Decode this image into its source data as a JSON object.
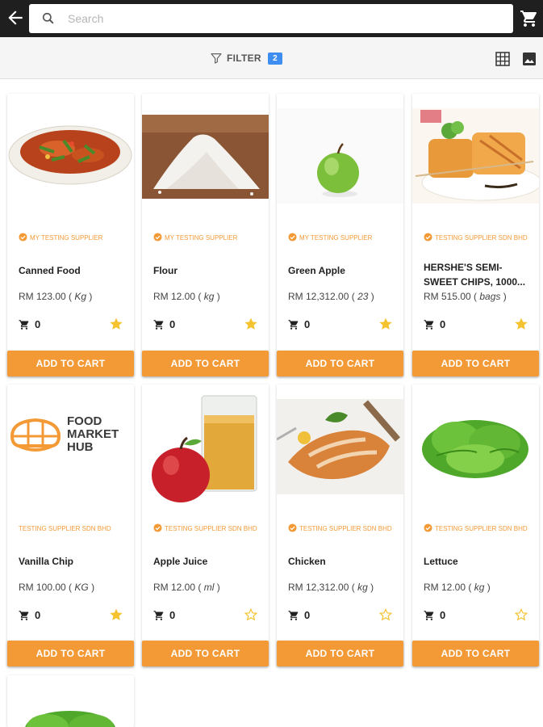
{
  "header": {
    "back_icon": "arrow-back-icon",
    "search_placeholder": "Search",
    "cart_icon": "cart-icon"
  },
  "toolbar": {
    "filter_label": "FILTER",
    "filter_count": "2",
    "view_icons": [
      "grid-view-icon",
      "image-view-icon"
    ]
  },
  "colors": {
    "accent": "#f39a37",
    "badge": "#3d8ef0",
    "star": "#f5c330",
    "topbar": "#1f1f1f"
  },
  "products": [
    {
      "supplier": "MY TESTING SUPPLIER",
      "name": "Canned Food",
      "price": "RM 123.00 (",
      "unit": "Kg",
      "price_end": ")",
      "cart": "0",
      "favorite": true,
      "image": "canned-food-image",
      "button": "ADD TO CART"
    },
    {
      "supplier": "MY TESTING SUPPLIER",
      "name": "Flour",
      "price": "RM 12.00 (",
      "unit": "kg",
      "price_end": ")",
      "cart": "0",
      "favorite": true,
      "image": "flour-image",
      "button": "ADD TO CART"
    },
    {
      "supplier": "MY TESTING SUPPLIER",
      "name": "Green Apple",
      "price": "RM 12,312.00 (",
      "unit": "23",
      "price_end": ")",
      "cart": "0",
      "favorite": true,
      "image": "green-apple-image",
      "button": "ADD TO CART"
    },
    {
      "supplier": "TESTING SUPPLIER SDN BHD",
      "name": "HERSHE'S SEMI-SWEET CHIPS, 1000...",
      "price": "RM 515.00 (",
      "unit": "bags",
      "price_end": ")",
      "cart": "0",
      "favorite": true,
      "image": "hershes-chips-image",
      "button": "ADD TO CART"
    },
    {
      "supplier": "TESTING SUPPLIER SDN BHD",
      "name": "Vanilla Chip",
      "price": "RM 100.00 (",
      "unit": "KG",
      "price_end": ")",
      "cart": "0",
      "favorite": true,
      "image": "food-market-hub-logo",
      "logo_text": [
        "FOOD",
        "MARKET",
        "HUB"
      ],
      "button": "ADD TO CART"
    },
    {
      "supplier": "TESTING SUPPLIER SDN BHD",
      "name": "Apple Juice",
      "price": "RM 12.00 (",
      "unit": "ml",
      "price_end": ")",
      "cart": "0",
      "favorite": false,
      "image": "apple-juice-image",
      "button": "ADD TO CART"
    },
    {
      "supplier": "TESTING SUPPLIER SDN BHD",
      "name": "Chicken",
      "price": "RM 12,312.00 (",
      "unit": "kg",
      "price_end": ")",
      "cart": "0",
      "favorite": false,
      "image": "chicken-image",
      "button": "ADD TO CART"
    },
    {
      "supplier": "TESTING SUPPLIER SDN BHD",
      "name": "Lettuce",
      "price": "RM 12.00 (",
      "unit": "kg",
      "price_end": ")",
      "cart": "0",
      "favorite": false,
      "image": "lettuce-image",
      "button": "ADD TO CART"
    }
  ]
}
